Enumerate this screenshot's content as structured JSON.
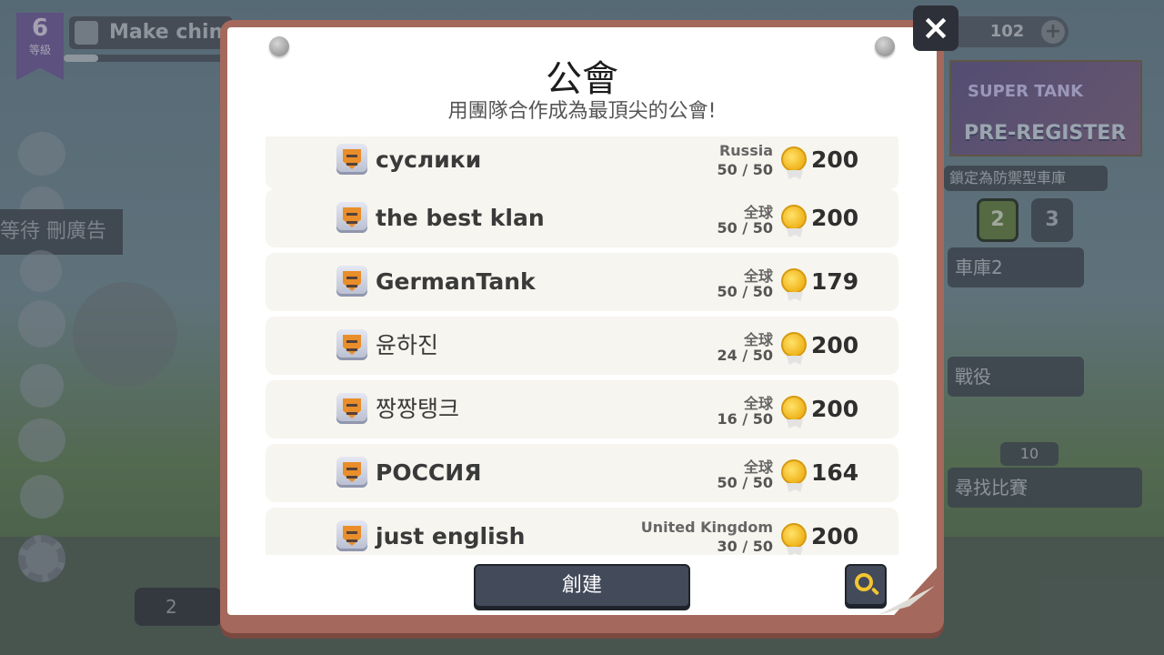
{
  "background": {
    "level_number": "6",
    "level_label": "等級",
    "player_name": "Make chin",
    "currency_value": "102",
    "currency_plus": "+",
    "promo_line1": "SUPER TANK",
    "promo_line2": "PRE-REGISTER",
    "garage_hint": "鎖定為防禦型車庫",
    "garage_slots": [
      "2",
      "3"
    ],
    "garage_name": "車庫2",
    "campaign_label": "戰役",
    "match_cost": "10",
    "find_match_label": "尋找比賽",
    "left_banner_text": "等待 刪廣告",
    "lock_value": "2"
  },
  "modal": {
    "close_icon": "×",
    "title": "公會",
    "subtitle": "用團隊合作成為最頂尖的公會!",
    "create_label": "創建",
    "guilds": [
      {
        "name": "суслики",
        "region": "Russia",
        "members": "50 / 50",
        "trophies": "200",
        "bold": true
      },
      {
        "name": "the best klan",
        "region": "全球",
        "members": "50 / 50",
        "trophies": "200",
        "bold": true
      },
      {
        "name": "GermanTank",
        "region": "全球",
        "members": "50 / 50",
        "trophies": "179",
        "bold": true
      },
      {
        "name": "윤하진",
        "region": "全球",
        "members": "24 / 50",
        "trophies": "200",
        "bold": false
      },
      {
        "name": "짱짱탱크",
        "region": "全球",
        "members": "16 / 50",
        "trophies": "200",
        "bold": false
      },
      {
        "name": "РОССИЯ",
        "region": "全球",
        "members": "50 / 50",
        "trophies": "164",
        "bold": true
      },
      {
        "name": "just english",
        "region": "United Kingdom",
        "members": "30 / 50",
        "trophies": "200",
        "bold": true
      }
    ]
  }
}
